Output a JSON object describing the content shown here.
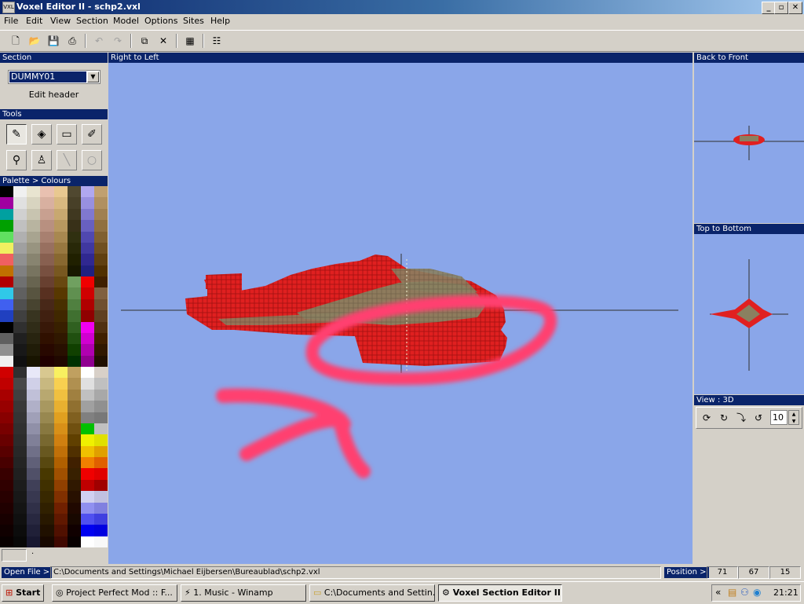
{
  "window": {
    "icon_text": "VXL",
    "title": "Voxel Editor II - schp2.vxl",
    "minimize": "_",
    "maximize": "▫",
    "close": "✕"
  },
  "menu": [
    "File",
    "Edit",
    "View",
    "Section",
    "Model",
    "Options",
    "Sites",
    "Help"
  ],
  "toolbar": {
    "icons": [
      "new-icon",
      "open-icon",
      "save-icon",
      "save-as-icon",
      "undo-icon",
      "redo-icon",
      "copy-section-icon",
      "delete-icon",
      "palette-icon",
      "properties-icon"
    ]
  },
  "section_panel": {
    "header": "Section",
    "selected": "DUMMY01",
    "edit_header": "Edit header"
  },
  "tools_panel": {
    "header": "Tools",
    "tools": [
      {
        "name": "pencil-tool",
        "glyph": "✎",
        "active": true,
        "enabled": true
      },
      {
        "name": "fill-tool",
        "glyph": "◈",
        "active": false,
        "enabled": true
      },
      {
        "name": "rectangle-tool",
        "glyph": "▭",
        "active": false,
        "enabled": true
      },
      {
        "name": "brush-replace-tool",
        "glyph": "✐",
        "active": false,
        "enabled": true
      },
      {
        "name": "dropper-tool",
        "glyph": "⚲",
        "active": false,
        "enabled": true
      },
      {
        "name": "brush-tool",
        "glyph": "♙",
        "active": false,
        "enabled": true
      },
      {
        "name": "line-tool",
        "glyph": "╲",
        "active": false,
        "enabled": false
      },
      {
        "name": "ellipse-tool",
        "glyph": "○",
        "active": false,
        "enabled": false
      }
    ]
  },
  "palette_panel": {
    "header": "Palette > Colours",
    "columns": [
      [
        "#000000",
        "#a000a0",
        "#00a0a0",
        "#00a000",
        "#60e060",
        "#f0f060",
        "#f06060",
        "#c07000",
        "#b00000",
        "#30c8e8",
        "#4060f0",
        "#2040c0",
        "#000000",
        "#606060",
        "#909090",
        "#f0f0f0",
        "#d00000",
        "#c00000",
        "#a80000",
        "#980000",
        "#880000",
        "#780000",
        "#680000",
        "#580000",
        "#480000",
        "#380000",
        "#300000",
        "#280000",
        "#200000",
        "#180000",
        "#100000",
        "#080000"
      ],
      [
        "#f0f0f0",
        "#e0e0e0",
        "#d0d0d0",
        "#c0c0c0",
        "#b0b0b0",
        "#a0a0a0",
        "#909090",
        "#808080",
        "#707070",
        "#606060",
        "#505050",
        "#404040",
        "#303030",
        "#202020",
        "#181818",
        "#101010",
        "#303030",
        "#484848",
        "#404040",
        "#383838",
        "#343434",
        "#303030",
        "#2c2c2c",
        "#282828",
        "#242424",
        "#202020",
        "#1c1c1c",
        "#181818",
        "#141414",
        "#101010",
        "#0c0c0c",
        "#080808"
      ],
      [
        "#e8e4d0",
        "#d8d4c0",
        "#c8c4b0",
        "#b8b4a0",
        "#a8a490",
        "#989480",
        "#888470",
        "#787460",
        "#686450",
        "#585440",
        "#484430",
        "#383420",
        "#302c18",
        "#282410",
        "#201c08",
        "#181400",
        "#e8e8f8",
        "#d0d0e8",
        "#c0c0d8",
        "#b0b0c8",
        "#a0a0b8",
        "#9090a8",
        "#808098",
        "#707088",
        "#606078",
        "#505068",
        "#404058",
        "#383850",
        "#303048",
        "#282840",
        "#202038",
        "#181830"
      ],
      [
        "#e8c0b0",
        "#d8b0a0",
        "#c8a090",
        "#b89080",
        "#a88070",
        "#987060",
        "#886050",
        "#785040",
        "#684030",
        "#583020",
        "#482818",
        "#402010",
        "#381808",
        "#301000",
        "#280800",
        "#200000",
        "#d8c890",
        "#c8b880",
        "#b8a870",
        "#a89860",
        "#988850",
        "#887840",
        "#786830",
        "#685820",
        "#584810",
        "#483800",
        "#403000",
        "#382800",
        "#302000",
        "#281800",
        "#201000",
        "#180800"
      ],
      [
        "#e8c890",
        "#d8b880",
        "#c8a870",
        "#b89860",
        "#a88850",
        "#987840",
        "#886830",
        "#785820",
        "#684810",
        "#583800",
        "#483000",
        "#402800",
        "#382000",
        "#301800",
        "#281000",
        "#200800",
        "#f8f060",
        "#f8d050",
        "#f0c040",
        "#e8b030",
        "#e0a020",
        "#d89018",
        "#d08010",
        "#c07008",
        "#b06000",
        "#a05000",
        "#904000",
        "#803000",
        "#702000",
        "#601800",
        "#501000",
        "#400800"
      ],
      [
        "#504830",
        "#484028",
        "#403820",
        "#383018",
        "#303010",
        "#282808",
        "#202000",
        "#181800",
        "#70a060",
        "#609050",
        "#508040",
        "#407030",
        "#306020",
        "#205010",
        "#104000",
        "#003000",
        "#c0a060",
        "#b09050",
        "#a08040",
        "#907030",
        "#806020",
        "#705010",
        "#604000",
        "#503000",
        "#402000",
        "#382000",
        "#301800",
        "#281000",
        "#200800",
        "#180800",
        "#100000",
        "#080000"
      ],
      [
        "#b0a8f0",
        "#9890e0",
        "#8078d0",
        "#6860c0",
        "#5048b0",
        "#4038a0",
        "#302890",
        "#202080",
        "#f00000",
        "#d00000",
        "#b00000",
        "#900000",
        "#f000f0",
        "#d000d0",
        "#b000b0",
        "#900090",
        "#ffffff",
        "#e0e0e0",
        "#c0c0c0",
        "#a0a0a0",
        "#808080",
        "#00c000",
        "#f0f000",
        "#f0c000",
        "#f08000",
        "#f00000",
        "#c00000",
        "#d0d0f0",
        "#9090f0",
        "#5050f0",
        "#0000f0",
        "#ffffff"
      ],
      [
        "#c0a070",
        "#b09060",
        "#a08050",
        "#907040",
        "#806030",
        "#705020",
        "#604010",
        "#503000",
        "#402000",
        "#806040",
        "#705030",
        "#604020",
        "#503010",
        "#402000",
        "#301800",
        "#201000",
        "#d8d0c8",
        "#c0c0c0",
        "#a8a8a8",
        "#909090",
        "#787878",
        "#c0c0c0",
        "#e0e000",
        "#e0a000",
        "#e06000",
        "#e00000",
        "#a00000",
        "#c0c0e0",
        "#8080e0",
        "#4040e0",
        "#0000e0",
        "#f8f8f8"
      ]
    ],
    "selected_swatch": "",
    "selected_index_label": "·"
  },
  "main_view": {
    "header": "Right to Left"
  },
  "side_views": {
    "back_to_front": "Back to Front",
    "top_to_bottom": "Top to Bottom",
    "view_3d": "View : 3D",
    "zoom_value": "10"
  },
  "status": {
    "open_file_label": "Open File >",
    "file_path": "C:\\Documents and Settings\\Michael Eijbersen\\Bureaublad\\schp2.vxl",
    "position_label": "Position >",
    "x": "71",
    "y": "67",
    "z": "15"
  },
  "taskbar": {
    "start": "Start",
    "tasks": [
      {
        "label": "Project Perfect Mod :: F...",
        "icon": "browser-icon",
        "active": false
      },
      {
        "label": "1. Music - Winamp",
        "icon": "winamp-icon",
        "active": false
      },
      {
        "label": "C:\\Documents and Settin...",
        "icon": "folder-icon",
        "active": false
      },
      {
        "label": "Voxel Section Editor II",
        "icon": "gear-icon",
        "active": true
      }
    ],
    "tray_chevron": "«",
    "clock": "21:21"
  }
}
